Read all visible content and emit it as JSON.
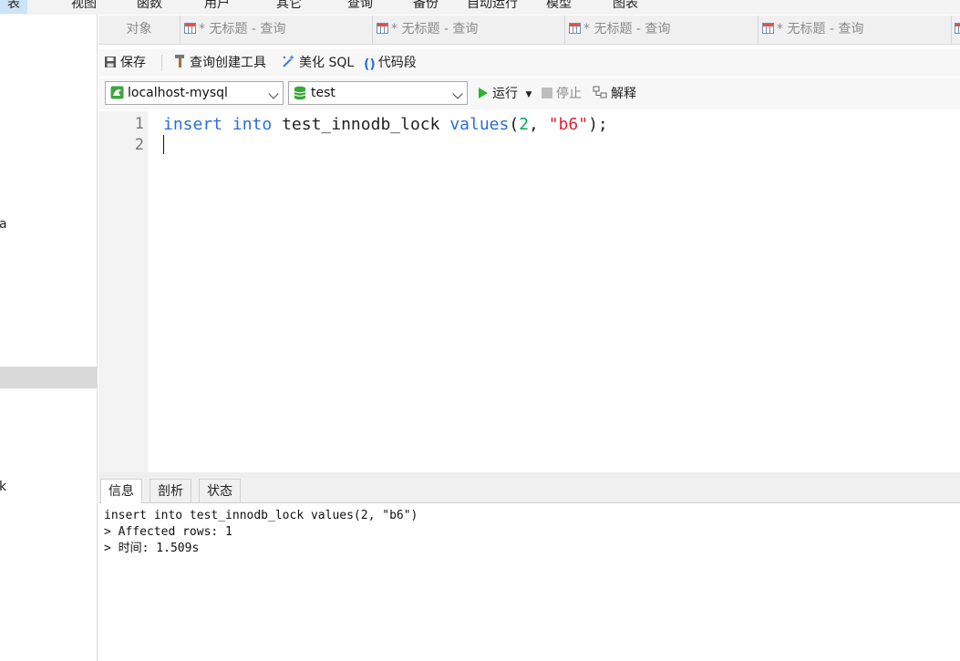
{
  "menu": {
    "items": [
      "表",
      "视图",
      "函数",
      "用户",
      "其它",
      "查询",
      "备份",
      "自动运行",
      "模型",
      "图表"
    ]
  },
  "left_panel": {
    "fragments": [
      "a",
      "k"
    ]
  },
  "tabs": {
    "objects": "对象",
    "queries": [
      "* 无标题 - 查询",
      "* 无标题 - 查询",
      "* 无标题 - 查询",
      "* 无标题 - 查询"
    ]
  },
  "toolbar1": {
    "save": "保存",
    "query_builder": "查询创建工具",
    "beautify": "美化 SQL",
    "snippet": "代码段"
  },
  "toolbar2": {
    "connection": "localhost-mysql",
    "database": "test",
    "run": "运行",
    "stop": "停止",
    "explain": "解释"
  },
  "editor": {
    "line_numbers": [
      "1",
      "2"
    ],
    "code": {
      "kw1": "insert",
      "kw2": "into",
      "table": "test_innodb_lock",
      "kw3": "values",
      "open": "(",
      "num": "2",
      "comma": ", ",
      "str": "\"b6\"",
      "close": ");"
    }
  },
  "result_tabs": [
    "信息",
    "剖析",
    "状态"
  ],
  "result": {
    "line1": "insert into test_innodb_lock values(2, \"b6\")",
    "line2": "> Affected rows: 1",
    "line3": "> 时间: 1.509s"
  },
  "colors": {
    "keyword": "#2a6fd6",
    "number": "#0aa05a",
    "string": "#e0243b",
    "run": "#2db52d"
  }
}
